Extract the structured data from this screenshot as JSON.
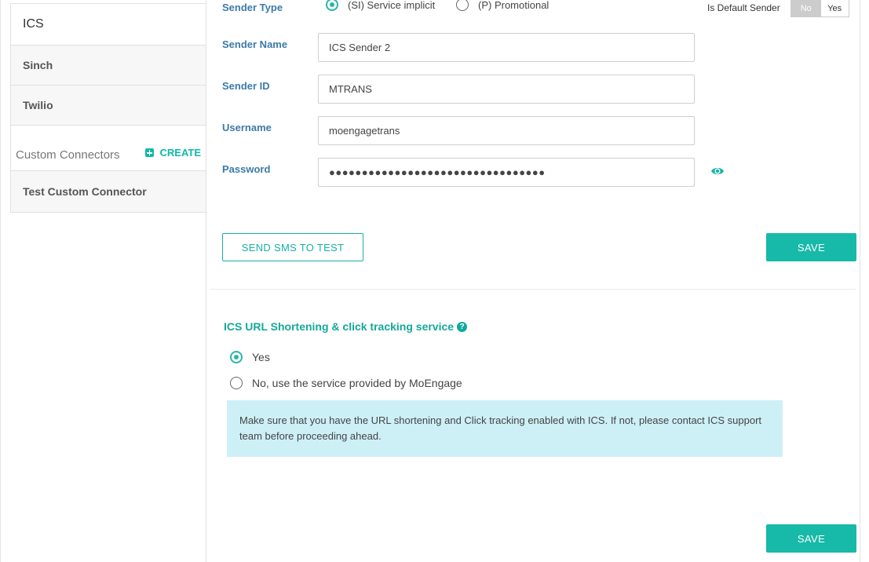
{
  "sidebar": {
    "items": [
      {
        "label": "ICS"
      },
      {
        "label": "Sinch"
      },
      {
        "label": "Twilio"
      }
    ],
    "custom_connectors": {
      "title": "Custom Connectors",
      "create_label": "CREATE",
      "items": [
        {
          "label": "Test Custom Connector"
        }
      ]
    }
  },
  "form": {
    "sender_type_label": "Sender Type",
    "sender_type_options": [
      {
        "label": "(SI) Service implicit",
        "selected": true
      },
      {
        "label": "(P) Promotional",
        "selected": false
      }
    ],
    "default_sender": {
      "label": "Is Default Sender",
      "no": "No",
      "yes": "Yes"
    },
    "sender_name_label": "Sender Name",
    "sender_name_value": "ICS Sender 2",
    "sender_id_label": "Sender ID",
    "sender_id_value": "MTRANS",
    "username_label": "Username",
    "username_value": "moengagetrans",
    "password_label": "Password",
    "password_value": "●●●●●●●●●●●●●●●●●●●●●●●●●●●●●●●●●"
  },
  "buttons": {
    "send_test": "SEND SMS TO TEST",
    "save": "SAVE",
    "save_bottom": "SAVE"
  },
  "url_section": {
    "title": "ICS URL Shortening & click tracking service",
    "help_glyph": "?",
    "options": [
      {
        "label": "Yes",
        "selected": true
      },
      {
        "label": "No, use the service provided by MoEngage",
        "selected": false
      }
    ],
    "info": "Make sure that you have the URL shortening and Click tracking enabled with ICS. If not, please contact ICS support team before proceeding ahead."
  },
  "colors": {
    "accent": "#17b9a8",
    "label": "#3b7ba8",
    "info_bg": "#cdf0f7"
  }
}
